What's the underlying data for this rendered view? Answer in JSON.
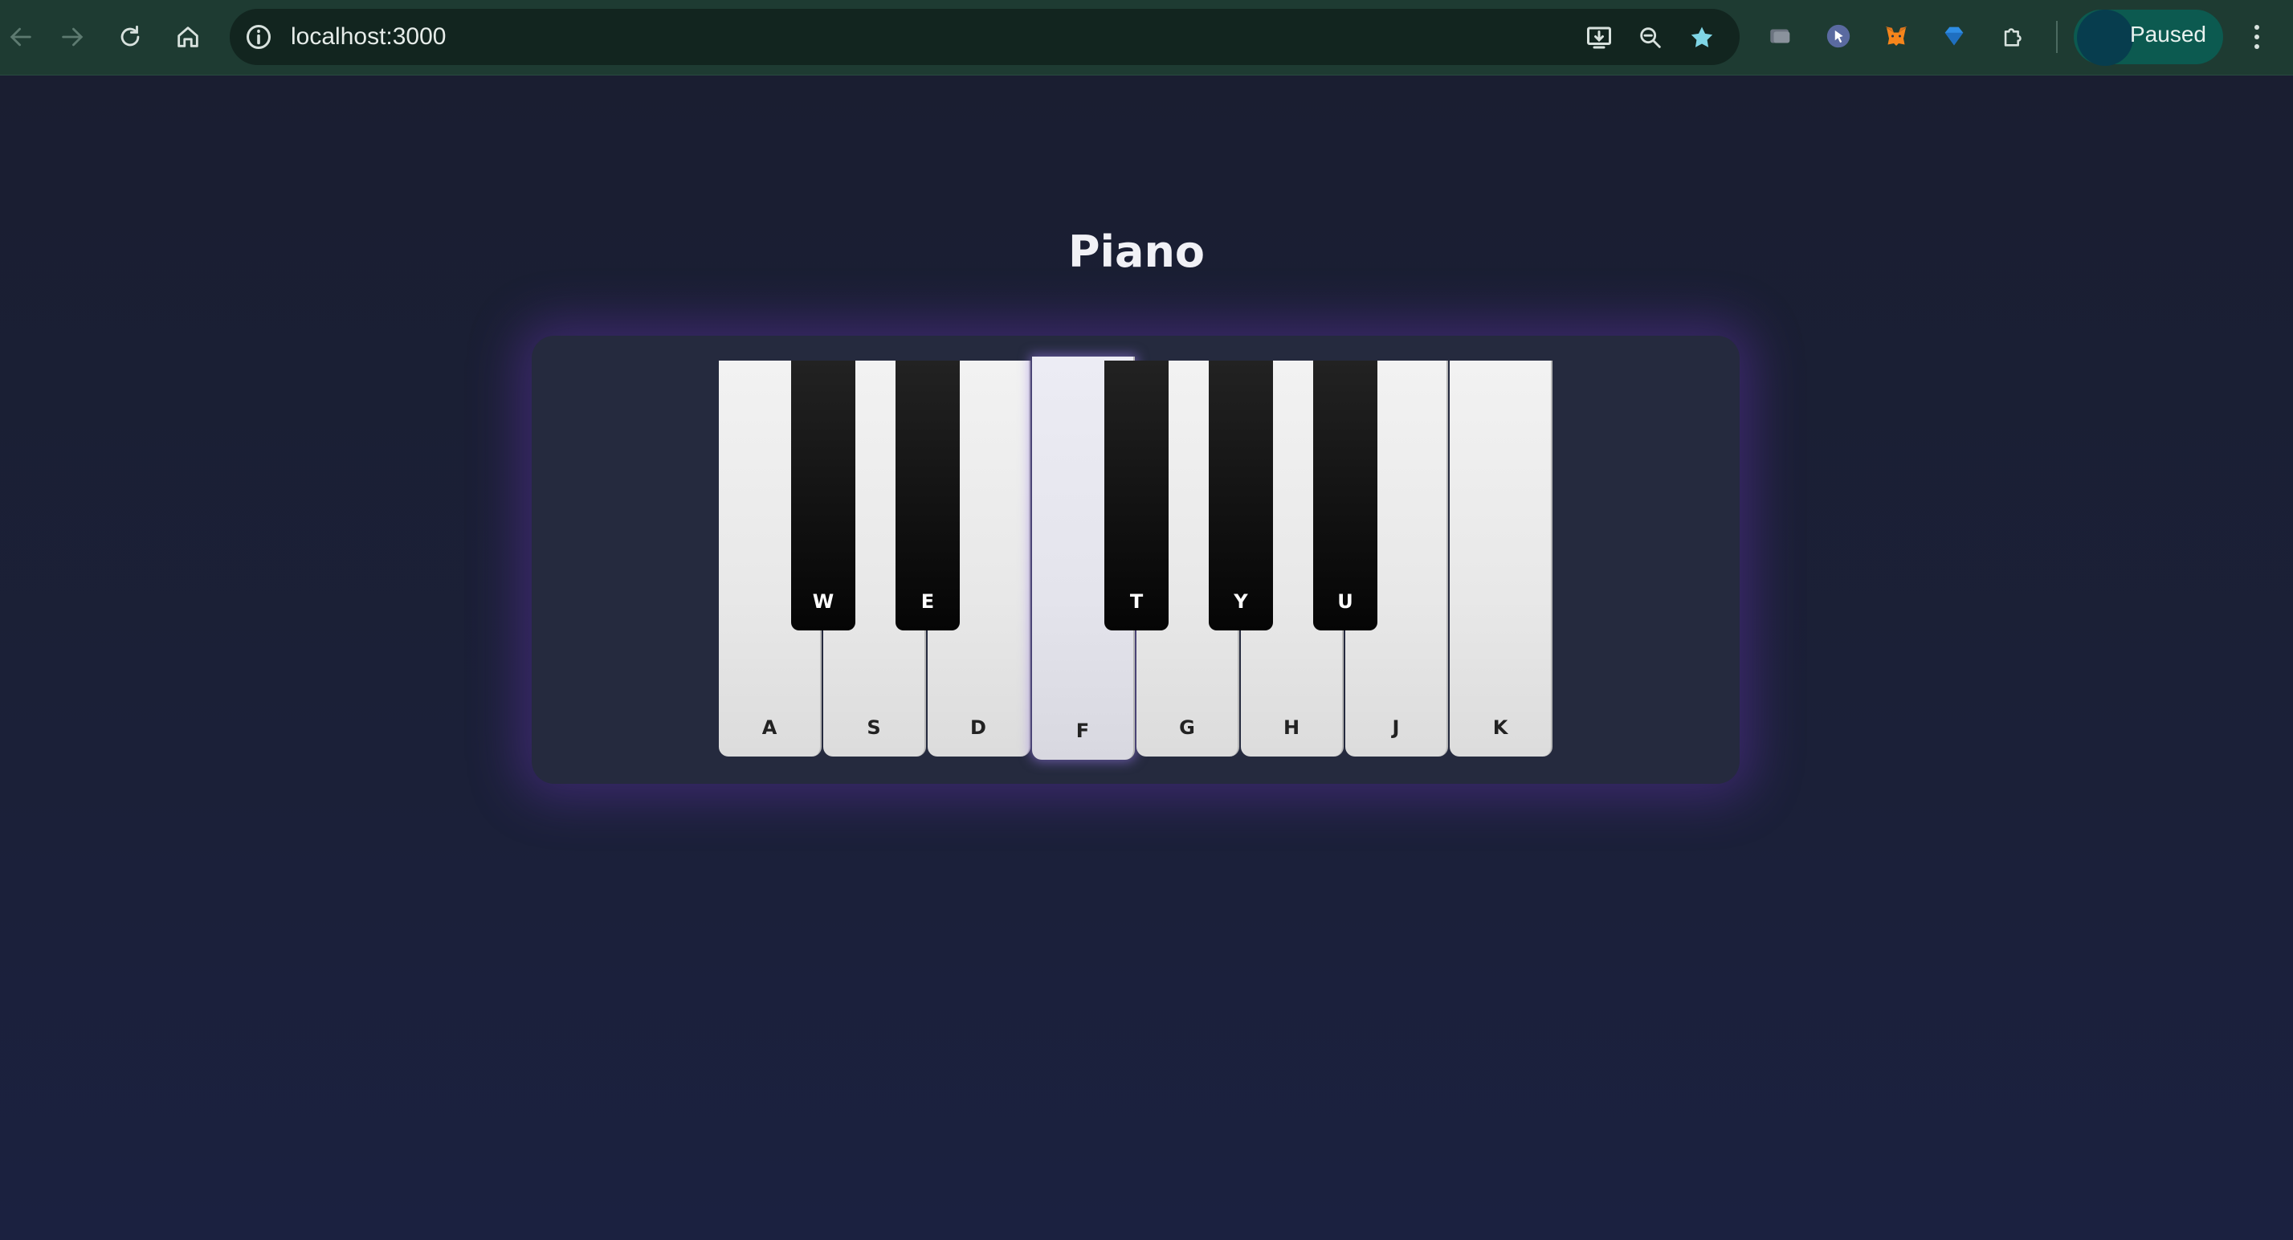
{
  "browser": {
    "url": "localhost:3000",
    "profile_status": "Paused",
    "accent": "#1e3b32"
  },
  "icons": {
    "back": "back-arrow-icon",
    "forward": "forward-arrow-icon",
    "reload": "reload-icon",
    "home": "home-icon",
    "site_info": "info-icon",
    "install": "install-app-icon",
    "zoom": "zoom-out-icon",
    "bookmark": "star-icon",
    "extensions": [
      "tab-group-extension-icon",
      "cursor-extension-icon",
      "metamask-fox-icon",
      "diamond-extension-icon",
      "puzzle-extensions-icon"
    ],
    "menu": "kebab-menu-icon"
  },
  "page": {
    "title": "Piano"
  },
  "piano": {
    "white_keys": [
      {
        "label": "A",
        "active": false
      },
      {
        "label": "S",
        "active": false
      },
      {
        "label": "D",
        "active": false
      },
      {
        "label": "F",
        "active": true
      },
      {
        "label": "G",
        "active": false
      },
      {
        "label": "H",
        "active": false
      },
      {
        "label": "J",
        "active": false
      },
      {
        "label": "K",
        "active": false
      }
    ],
    "black_keys": [
      {
        "label": "W"
      },
      {
        "label": "E"
      },
      {
        "label": "T"
      },
      {
        "label": "Y"
      },
      {
        "label": "U"
      }
    ]
  }
}
